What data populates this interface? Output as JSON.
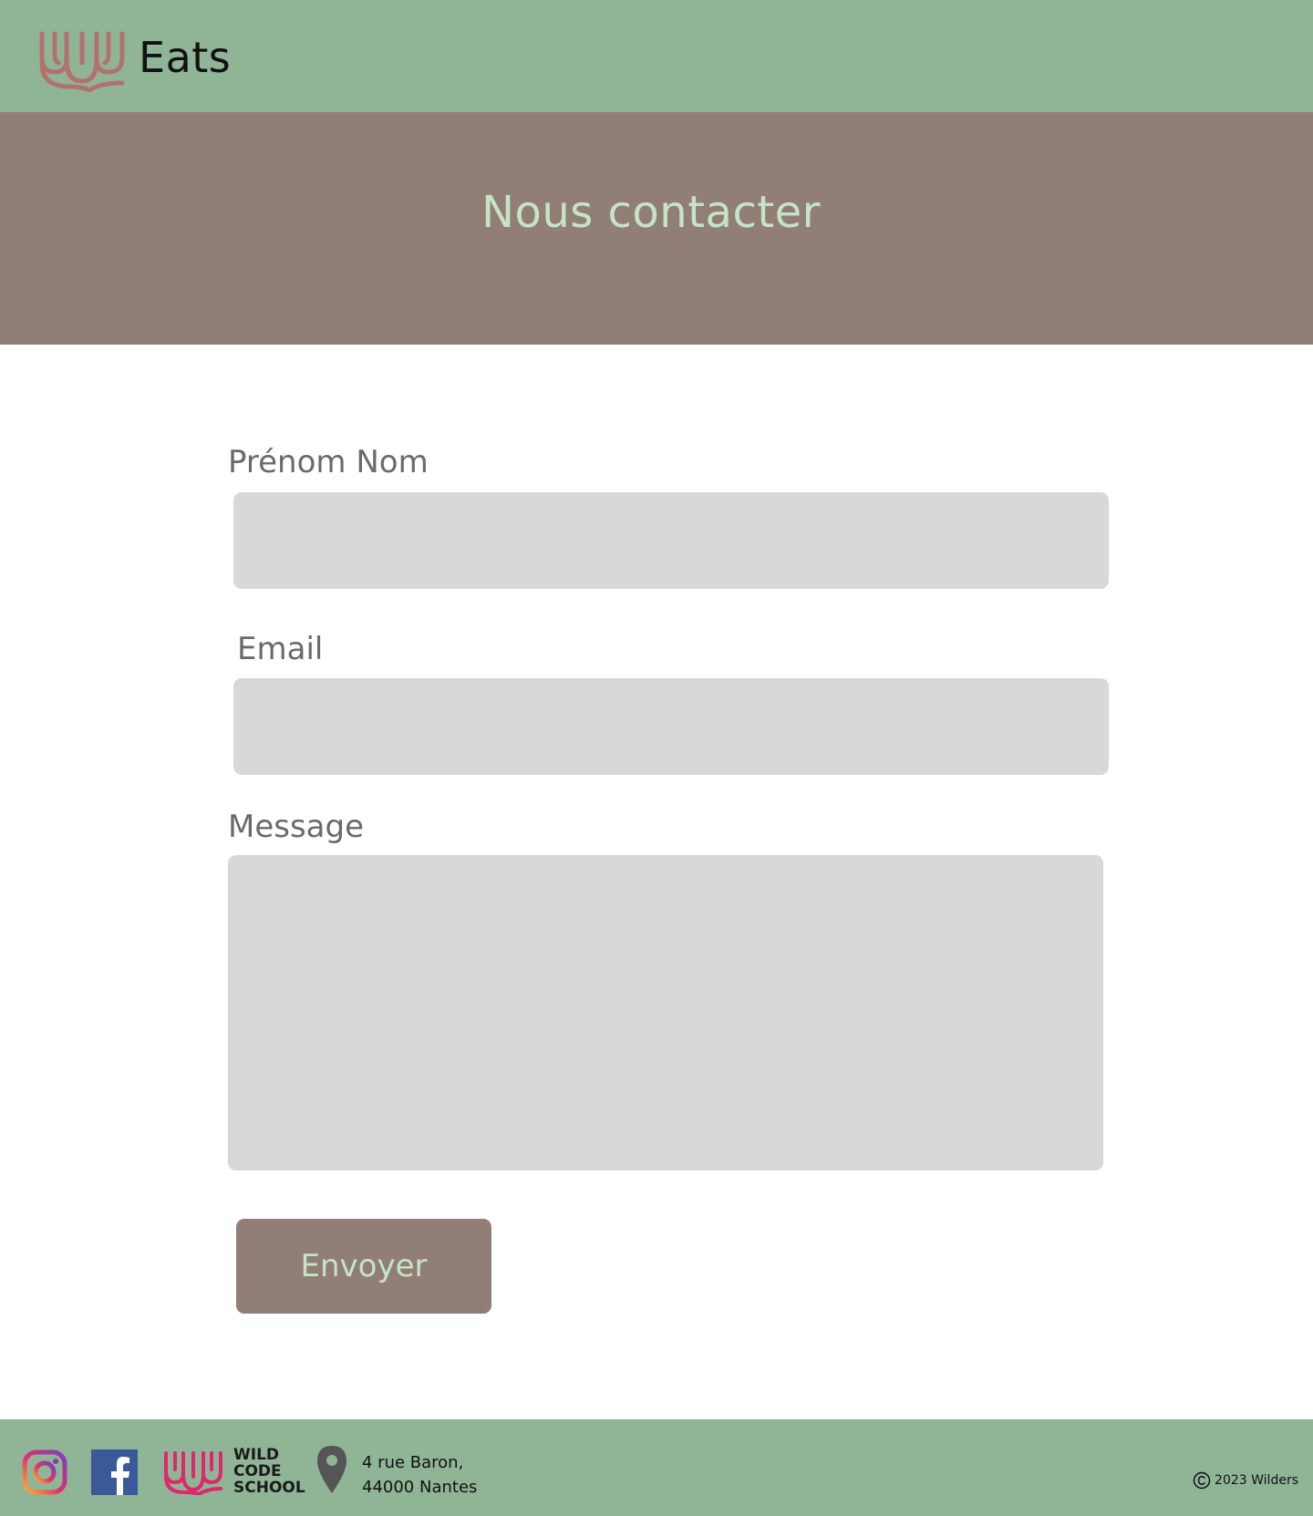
{
  "header": {
    "brand": "Eats"
  },
  "hero": {
    "title": "Nous contacter"
  },
  "form": {
    "name_label": "Prénom Nom",
    "name_value": "",
    "email_label": "Email",
    "email_value": "",
    "message_label": "Message",
    "message_value": "",
    "submit_label": "Envoyer"
  },
  "footer": {
    "social_icons": [
      "instagram-icon",
      "facebook-icon"
    ],
    "school_lines": [
      "WILD",
      "CODE",
      "SCHOOL"
    ],
    "address_line1": "4 rue Baron,",
    "address_line2": "44000 Nantes",
    "copyright": "2023 Wilders"
  },
  "colors": {
    "header_bg": "#8fb596",
    "hero_bg": "#917f77",
    "hero_text": "#c6e3c5",
    "field_bg": "#d8d8d8",
    "logo": "#b3716d",
    "wcs_pink": "#e0266d",
    "facebook": "#3b5998"
  }
}
